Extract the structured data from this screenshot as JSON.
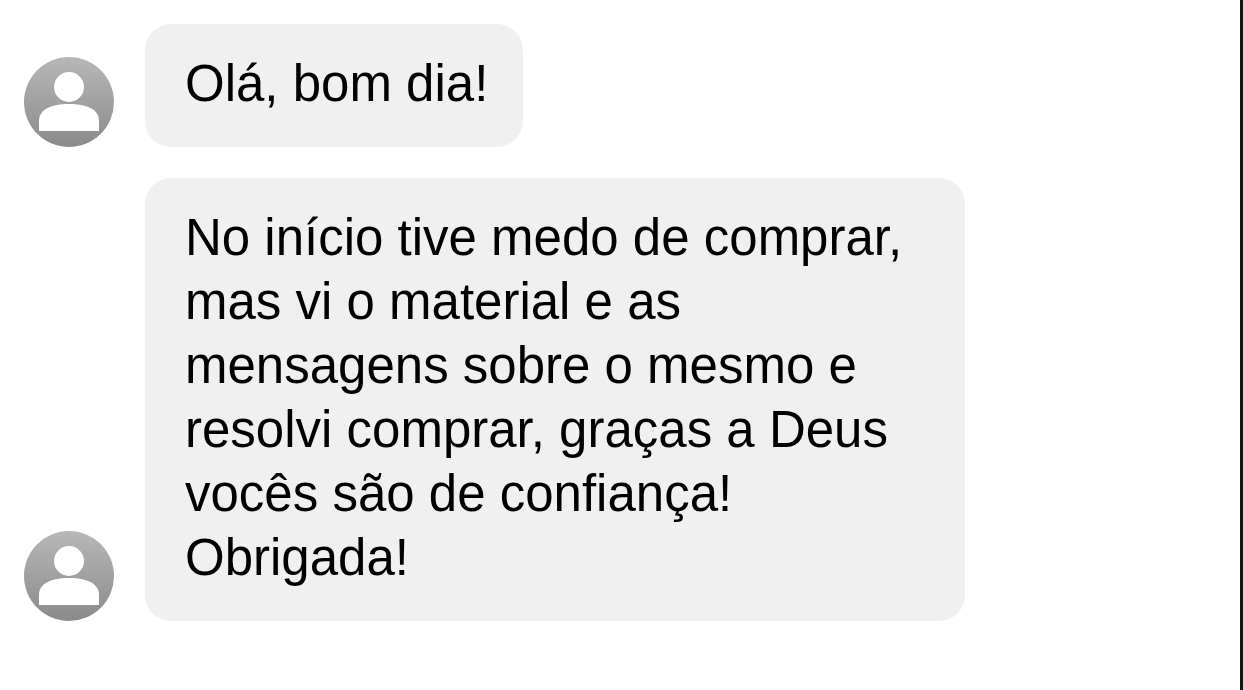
{
  "messages": [
    {
      "text": "Olá, bom dia!"
    },
    {
      "text": "No início tive medo de comprar, mas vi o material e as mensagens sobre o mesmo e resolvi comprar, graças a Deus vocês são de confiança! Obrigada!"
    }
  ]
}
